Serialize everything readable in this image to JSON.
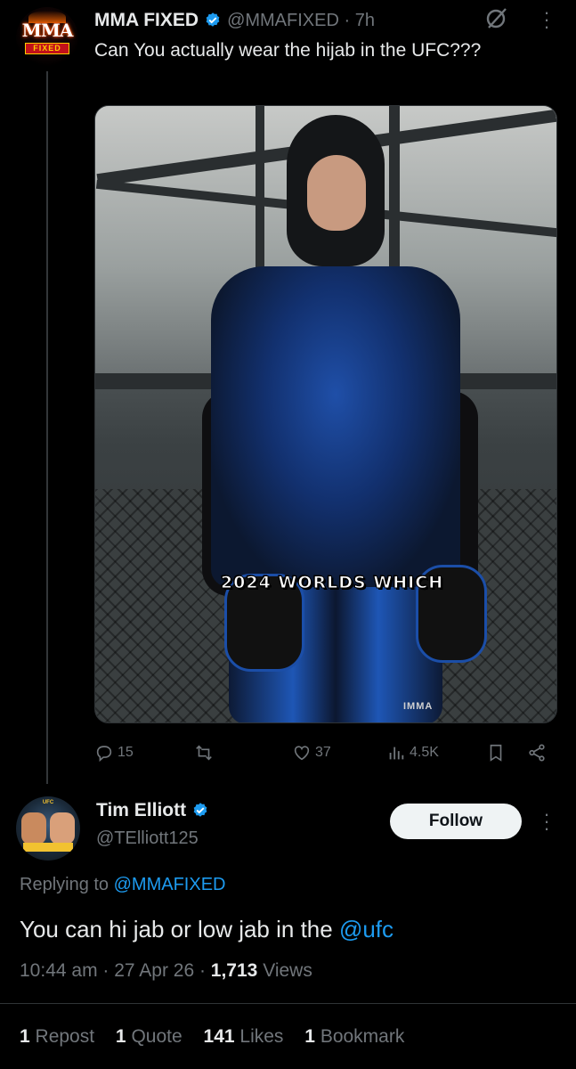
{
  "colors": {
    "background": "#000000",
    "text": "#e7e9ea",
    "muted": "#71767b",
    "link": "#1d9bf0",
    "verified": "#1d9bf0"
  },
  "parent_tweet": {
    "author_name": "MMA FIXED",
    "handle_time": "@MMAFIXED · 7h",
    "text": "Can You actually wear the hijab in the UFC???",
    "avatar": {
      "label_top": "MMA",
      "label_band": "FIXED"
    },
    "media": {
      "caption": "2024 WORLDS WHICH",
      "watermark": "IMMA"
    },
    "actions": {
      "replies": "15",
      "retweets": "",
      "likes": "37",
      "views": "4.5K"
    }
  },
  "reply": {
    "author_name": "Tim Elliott",
    "handle": "@TElliott125",
    "follow_label": "Follow",
    "replying_prefix": "Replying to ",
    "replying_to": "@MMAFIXED",
    "text_main": "You can hi jab or low jab in the ",
    "text_mention": "@ufc",
    "time_date": "10:44 am · 27 Apr 26 · ",
    "views_count": "1,713",
    "views_label": " Views",
    "stats": {
      "reposts_count": "1",
      "reposts_label": "Repost",
      "quotes_count": "1",
      "quotes_label": "Quote",
      "likes_count": "141",
      "likes_label": "Likes",
      "bookmarks_count": "1",
      "bookmarks_label": "Bookmark"
    }
  }
}
